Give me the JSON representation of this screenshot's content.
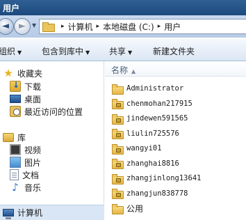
{
  "window": {
    "title": "用户"
  },
  "address": {
    "crumbs": [
      "计算机",
      "本地磁盘 (C:)",
      "用户"
    ],
    "separator": "▸"
  },
  "toolbar": {
    "organize": "组织",
    "include_in_library": "包含到库中",
    "share": "共享",
    "new_folder": "新建文件夹"
  },
  "sidebar": {
    "favorites": "收藏夹",
    "favorites_items": [
      "下载",
      "桌面",
      "最近访问的位置"
    ],
    "libraries": "库",
    "library_items": [
      "视频",
      "图片",
      "文档",
      "音乐"
    ],
    "computer": "计算机"
  },
  "columns": {
    "name": "名称"
  },
  "files": [
    {
      "name": "Administrator",
      "locked": false
    },
    {
      "name": "chenmohan217915",
      "locked": true
    },
    {
      "name": "jindewen591565",
      "locked": true
    },
    {
      "name": "liulin725576",
      "locked": true
    },
    {
      "name": "wangyi01",
      "locked": true
    },
    {
      "name": "zhanghai8816",
      "locked": true
    },
    {
      "name": "zhangjinlong13641",
      "locked": true
    },
    {
      "name": "zhangjun838778",
      "locked": true
    },
    {
      "name": "公用",
      "locked": false
    }
  ]
}
